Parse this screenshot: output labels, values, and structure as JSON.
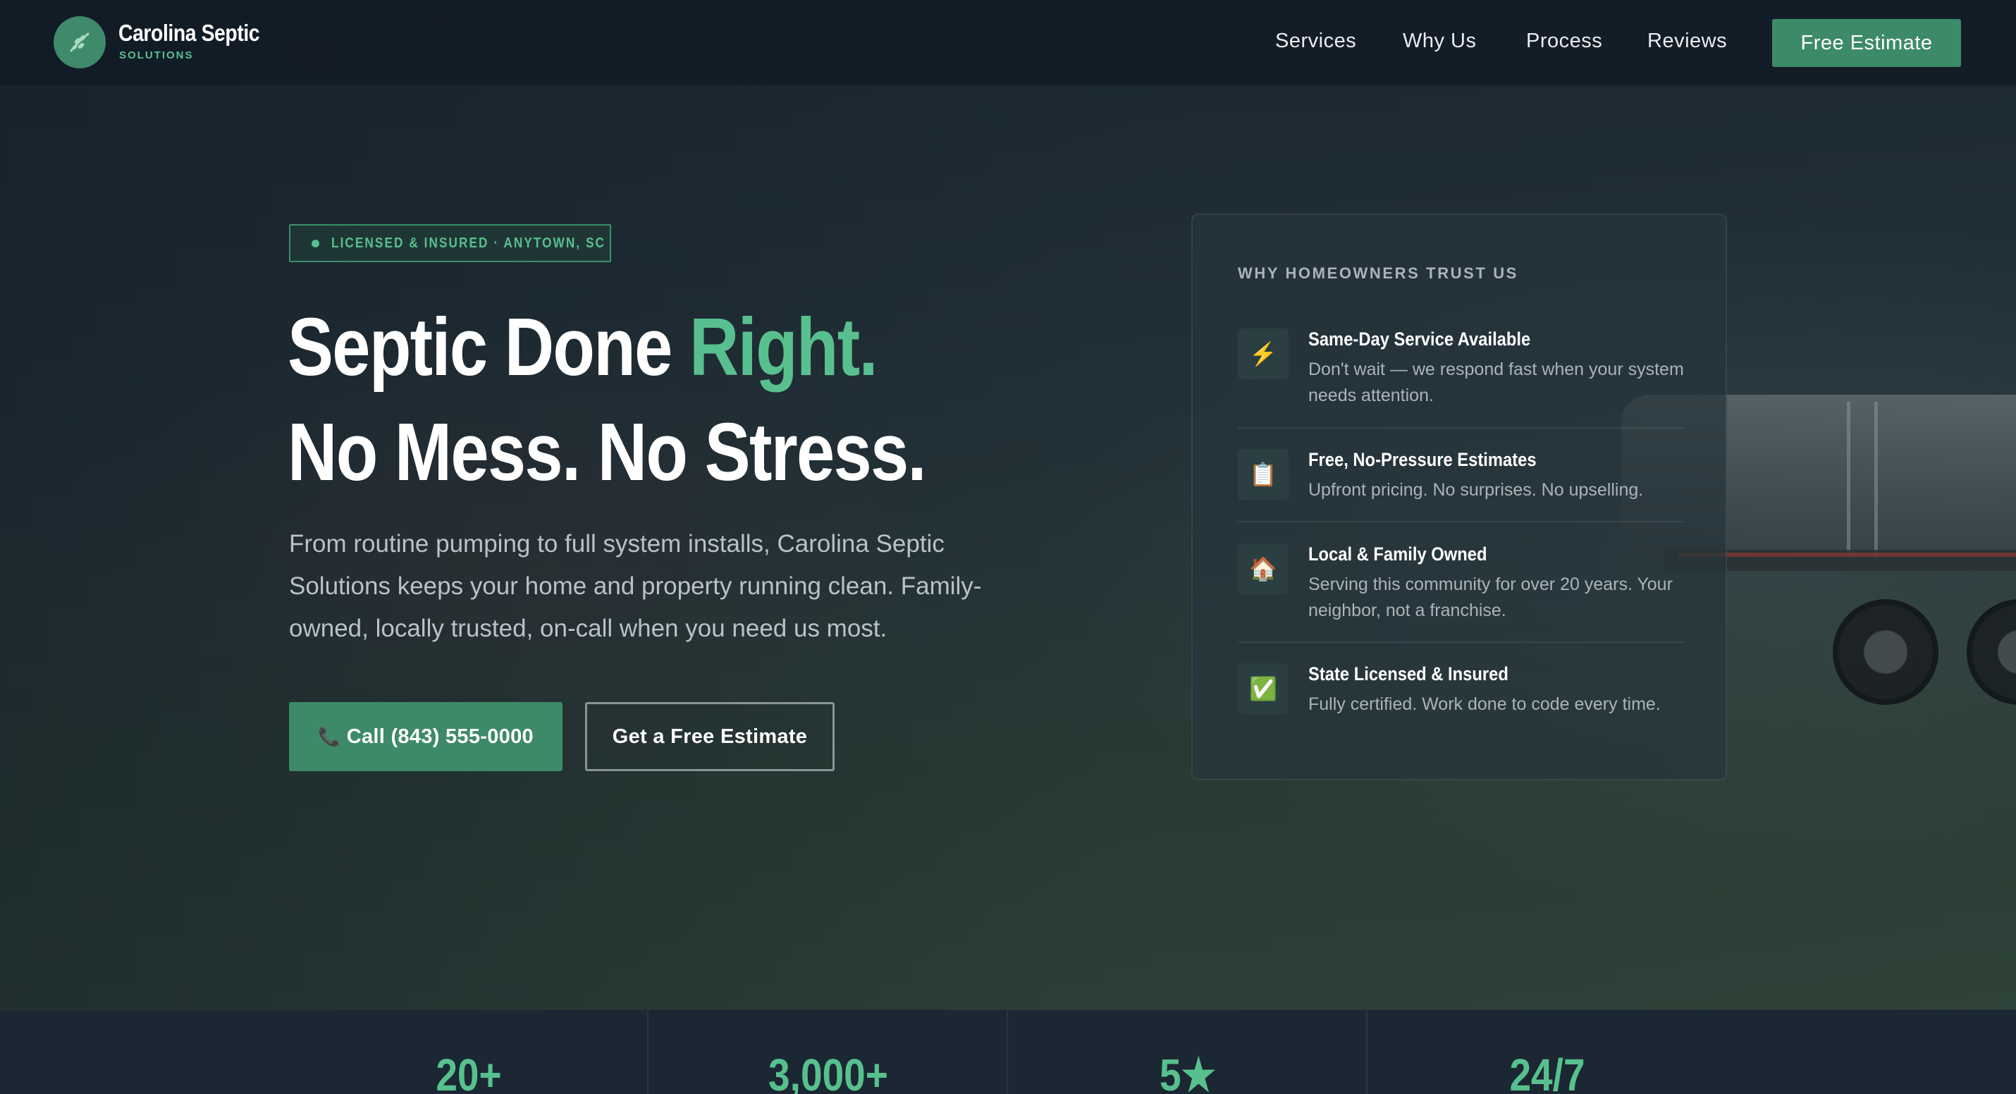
{
  "brand": {
    "name": "Carolina Septic",
    "tagline": "SOLUTIONS",
    "logo_icon": "leaf-icon"
  },
  "nav": {
    "links": [
      "Services",
      "Why Us",
      "Process",
      "Reviews"
    ],
    "cta": "Free Estimate"
  },
  "hero": {
    "badge": "LICENSED & INSURED · ANYTOWN, SC",
    "headline_line1_prefix": "Septic Done ",
    "headline_line1_accent": "Right.",
    "headline_line2": "No Mess. No Stress.",
    "lead": "From routine pumping to full system installs, Carolina Septic Solutions keeps your home and property running clean. Family-owned, locally trusted, on-call when you need us most.",
    "primary_button": "Call (843) 555-0000",
    "primary_button_icon": "📞",
    "secondary_button": "Get a Free Estimate"
  },
  "trust": {
    "title": "WHY HOMEOWNERS TRUST US",
    "items": [
      {
        "icon": "⚡",
        "icon_name": "lightning-icon",
        "title": "Same-Day Service Available",
        "desc": "Don't wait — we respond fast when your system needs attention."
      },
      {
        "icon": "📋",
        "icon_name": "clipboard-icon",
        "title": "Free, No-Pressure Estimates",
        "desc": "Upfront pricing. No surprises. No upselling."
      },
      {
        "icon": "🏠",
        "icon_name": "house-icon",
        "title": "Local & Family Owned",
        "desc": "Serving this community for over 20 years. Your neighbor, not a franchise."
      },
      {
        "icon": "✅",
        "icon_name": "check-icon",
        "title": "State Licensed & Insured",
        "desc": "Fully certified. Work done to code every time."
      }
    ]
  },
  "stats": [
    "20+",
    "3,000+",
    "5★",
    "24/7"
  ],
  "colors": {
    "accent": "#58c08e",
    "button": "#3d8a68",
    "nav_bg": "#121c26"
  }
}
